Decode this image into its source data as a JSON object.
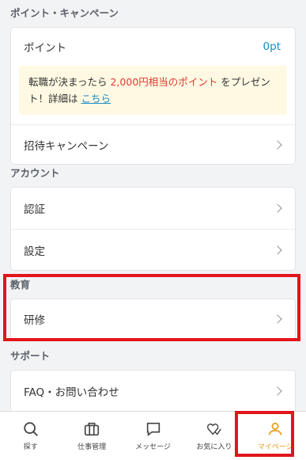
{
  "points_campaign": {
    "title": "ポイント・キャンペーン",
    "points_label": "ポイント",
    "points_value": "0pt",
    "promo_text_1": "転職が決まったら ",
    "promo_highlight": "2,000円相当のポイント",
    "promo_text_2": " をプレゼント！詳細は ",
    "promo_link": "こちら",
    "invite_label": "招待キャンペーン"
  },
  "account": {
    "title": "アカウント",
    "auth_label": "認証",
    "settings_label": "設定"
  },
  "education": {
    "title": "教育",
    "training_label": "研修"
  },
  "support": {
    "title": "サポート",
    "faq_label": "FAQ・お問い合わせ"
  },
  "nav": {
    "search": "探す",
    "jobs": "仕事管理",
    "messages": "メッセージ",
    "favorites": "お気に入り",
    "mypage": "マイページ"
  },
  "colors": {
    "accent": "#1a8dc4",
    "promo_red": "#e03a2f",
    "active_nav": "#e89a14",
    "highlight": "#e3141b"
  }
}
